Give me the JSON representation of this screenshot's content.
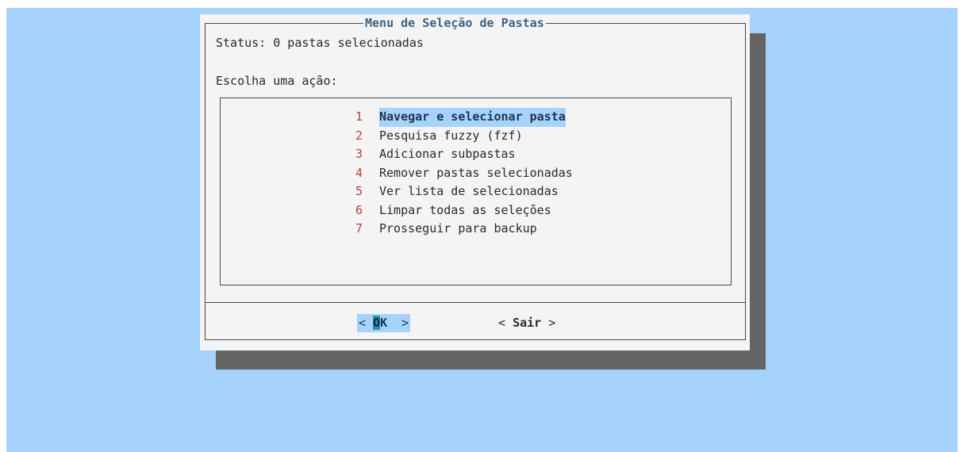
{
  "dialog": {
    "title": "Menu de Seleção de Pastas",
    "status": "Status: 0 pastas selecionadas",
    "prompt": "Escolha uma ação:"
  },
  "menu": {
    "items": [
      {
        "num": "1",
        "label": "Navegar e selecionar pasta",
        "selected": true
      },
      {
        "num": "2",
        "label": "Pesquisa fuzzy (fzf)",
        "selected": false
      },
      {
        "num": "3",
        "label": "Adicionar subpastas",
        "selected": false
      },
      {
        "num": "4",
        "label": "Remover pastas selecionadas",
        "selected": false
      },
      {
        "num": "5",
        "label": "Ver lista de selecionadas",
        "selected": false
      },
      {
        "num": "6",
        "label": "Limpar todas as seleções",
        "selected": false
      },
      {
        "num": "7",
        "label": "Prosseguir para backup",
        "selected": false
      }
    ]
  },
  "buttons": {
    "ok": {
      "left": "< ",
      "hot": "O",
      "rest": "K",
      "right": "  >"
    },
    "exit": {
      "left": "< ",
      "label": "Sair",
      "right": " >"
    }
  },
  "colors": {
    "screen_bg": "#a6d3fc",
    "dialog_bg": "#f4f4f4",
    "shadow": "#646464",
    "title": "#3e6287",
    "number": "#b9413e",
    "highlight": "#a6d3fc",
    "hotkey": "#2a8cb4"
  }
}
